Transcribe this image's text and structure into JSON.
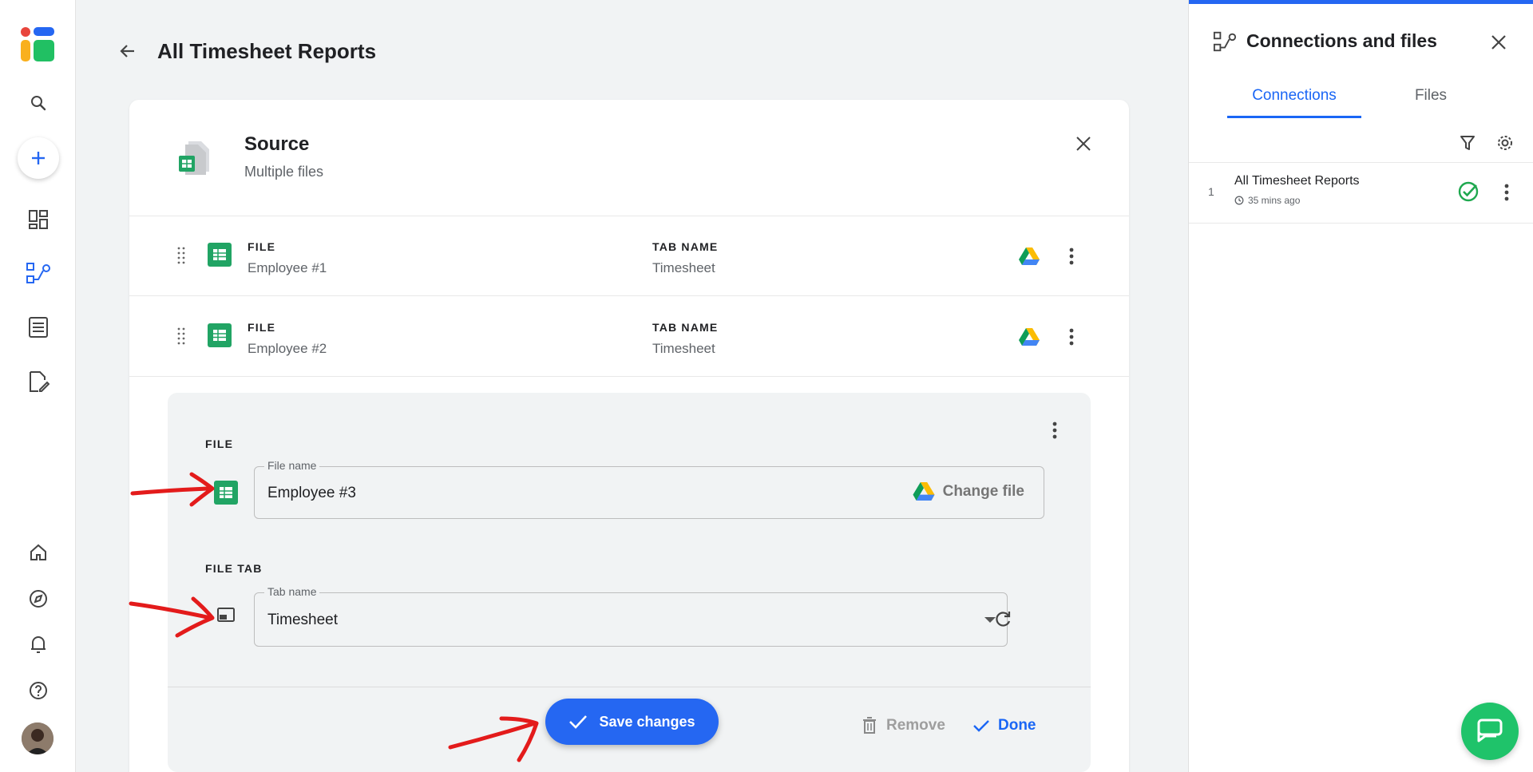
{
  "page": {
    "title": "All Timesheet Reports"
  },
  "source": {
    "title": "Source",
    "subtitle": "Multiple files",
    "rows": [
      {
        "file_label": "FILE",
        "file_value": "Employee #1",
        "tab_label": "TAB NAME",
        "tab_value": "Timesheet"
      },
      {
        "file_label": "FILE",
        "file_value": "Employee #2",
        "tab_label": "TAB NAME",
        "tab_value": "Timesheet"
      }
    ],
    "editor": {
      "file_section": "FILE",
      "file_field_label": "File name",
      "file_field_value": "Employee #3",
      "change_file": "Change file",
      "tab_section": "FILE TAB",
      "tab_field_label": "Tab name",
      "tab_field_value": "Timesheet",
      "remove": "Remove",
      "done": "Done"
    },
    "save_changes": "Save changes"
  },
  "panel": {
    "title": "Connections and files",
    "tabs": [
      {
        "label": "Connections",
        "active": true
      },
      {
        "label": "Files",
        "active": false
      }
    ],
    "connections": [
      {
        "number": "1",
        "name": "All Timesheet Reports",
        "time": "35 mins ago",
        "status": "success"
      }
    ]
  },
  "colors": {
    "accent": "#2567f2",
    "success": "#1fa84f",
    "sheets_green": "#21a464",
    "chat": "#1fc36a",
    "annotation": "#e31b1b"
  },
  "icons": [
    "search-icon",
    "plus-icon",
    "dashboard-icon",
    "connections-icon",
    "list-icon",
    "edit-doc-icon",
    "home-icon",
    "compass-icon",
    "bell-icon",
    "help-icon"
  ]
}
